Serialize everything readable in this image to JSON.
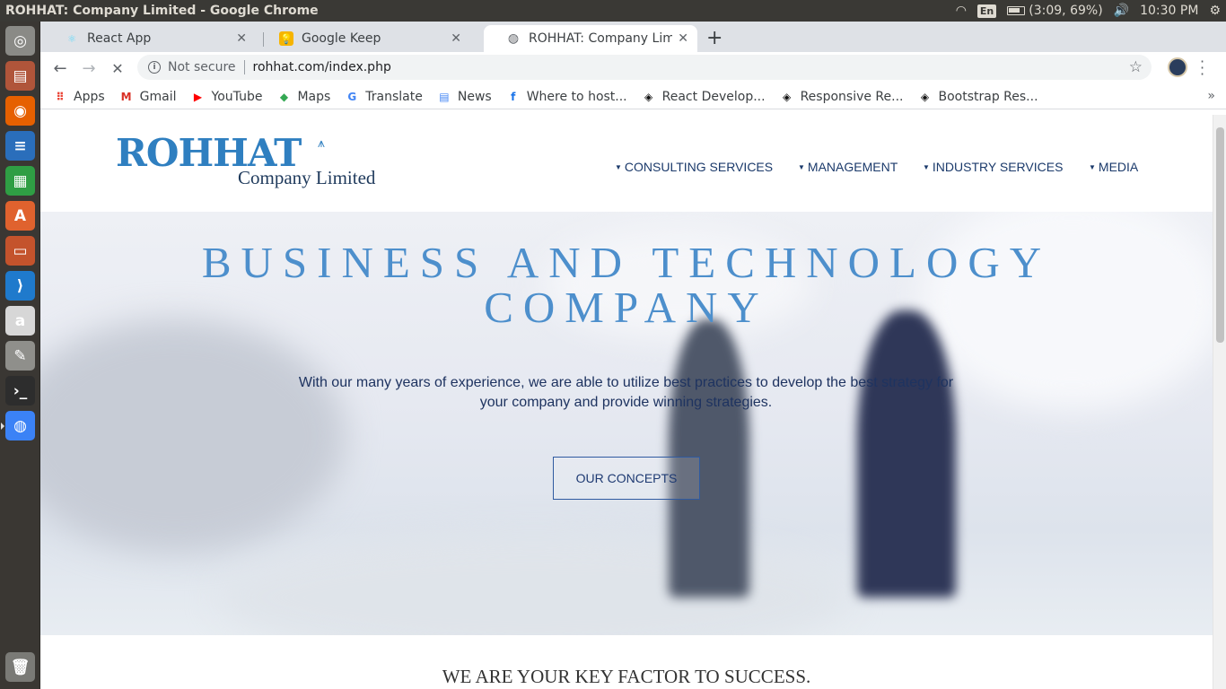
{
  "window_title": "ROHHAT: Company Limited - Google Chrome",
  "system_tray": {
    "language": "En",
    "battery": "(3:09, 69%)",
    "time": "10:30 PM"
  },
  "launcher": {
    "apps": [
      {
        "name": "ubuntu-dash-icon",
        "color": "#8a8a86",
        "glyph": "◎"
      },
      {
        "name": "files-icon",
        "color": "#b0553a",
        "glyph": "▤"
      },
      {
        "name": "firefox-icon",
        "color": "#e66000",
        "glyph": "◉"
      },
      {
        "name": "writer-icon",
        "color": "#2a6ebb",
        "glyph": "≡"
      },
      {
        "name": "calc-icon",
        "color": "#2f9e44",
        "glyph": "▦"
      },
      {
        "name": "software-center-icon",
        "color": "#e0622e",
        "glyph": "A"
      },
      {
        "name": "impress-icon",
        "color": "#c4532c",
        "glyph": "▭"
      },
      {
        "name": "vscode-icon",
        "color": "#1f7acc",
        "glyph": "⟩"
      },
      {
        "name": "amazon-icon",
        "color": "#d7d7d7",
        "glyph": "a"
      },
      {
        "name": "settings-icon",
        "color": "#8f8f8b",
        "glyph": "✎"
      },
      {
        "name": "terminal-icon",
        "color": "#2d2d2d",
        "glyph": "›_"
      },
      {
        "name": "chrome-icon",
        "color": "#3b82f6",
        "glyph": "◍"
      }
    ],
    "trash": "trash-icon"
  },
  "tabs": [
    {
      "title": "React App",
      "active": false,
      "icon": "react-icon",
      "icon_color": "#61dafb"
    },
    {
      "title": "Google Keep",
      "active": false,
      "icon": "keep-icon",
      "icon_color": "#f6b400"
    },
    {
      "title": "ROHHAT: Company Limite",
      "active": true,
      "icon": "globe-icon",
      "icon_color": "#5f6368"
    }
  ],
  "address_bar": {
    "security": "Not secure",
    "url": "rohhat.com/index.php"
  },
  "bookmarks": [
    {
      "label": "Apps",
      "icon": "apps-grid-icon",
      "color": "#ea4335"
    },
    {
      "label": "Gmail",
      "icon": "gmail-icon",
      "color": "#d93025"
    },
    {
      "label": "YouTube",
      "icon": "youtube-icon",
      "color": "#ff0000"
    },
    {
      "label": "Maps",
      "icon": "maps-icon",
      "color": "#34a853"
    },
    {
      "label": "Translate",
      "icon": "translate-icon",
      "color": "#4285f4"
    },
    {
      "label": "News",
      "icon": "news-icon",
      "color": "#4285f4"
    },
    {
      "label": "Where to host...",
      "icon": "freecodecamp-icon",
      "color": "#1a73e8"
    },
    {
      "label": "React Develop...",
      "icon": "codepen-icon",
      "color": "#111111"
    },
    {
      "label": "Responsive Re...",
      "icon": "codepen-icon",
      "color": "#111111"
    },
    {
      "label": "Bootstrap Res...",
      "icon": "codepen-icon",
      "color": "#111111"
    }
  ],
  "site": {
    "logo": {
      "main": "ROHHAT",
      "sub": "Company Limited"
    },
    "nav": [
      "CONSULTING SERVICES",
      "MANAGEMENT",
      "INDUSTRY SERVICES",
      "MEDIA"
    ],
    "hero": {
      "title_line1": "BUSINESS AND TECHNOLOGY",
      "title_line2": "COMPANY",
      "text": "With our many years of experience, we are able to utilize best practices to develop the best strategy for your company and provide winning strategies.",
      "button": "OUR CONCEPTS"
    },
    "tagline": "WE ARE YOUR KEY FACTOR TO SUCCESS."
  },
  "colors": {
    "brand_blue": "#2f7fc0",
    "nav_text": "#1b3a6b",
    "hero_title": "#4d8fcc"
  }
}
